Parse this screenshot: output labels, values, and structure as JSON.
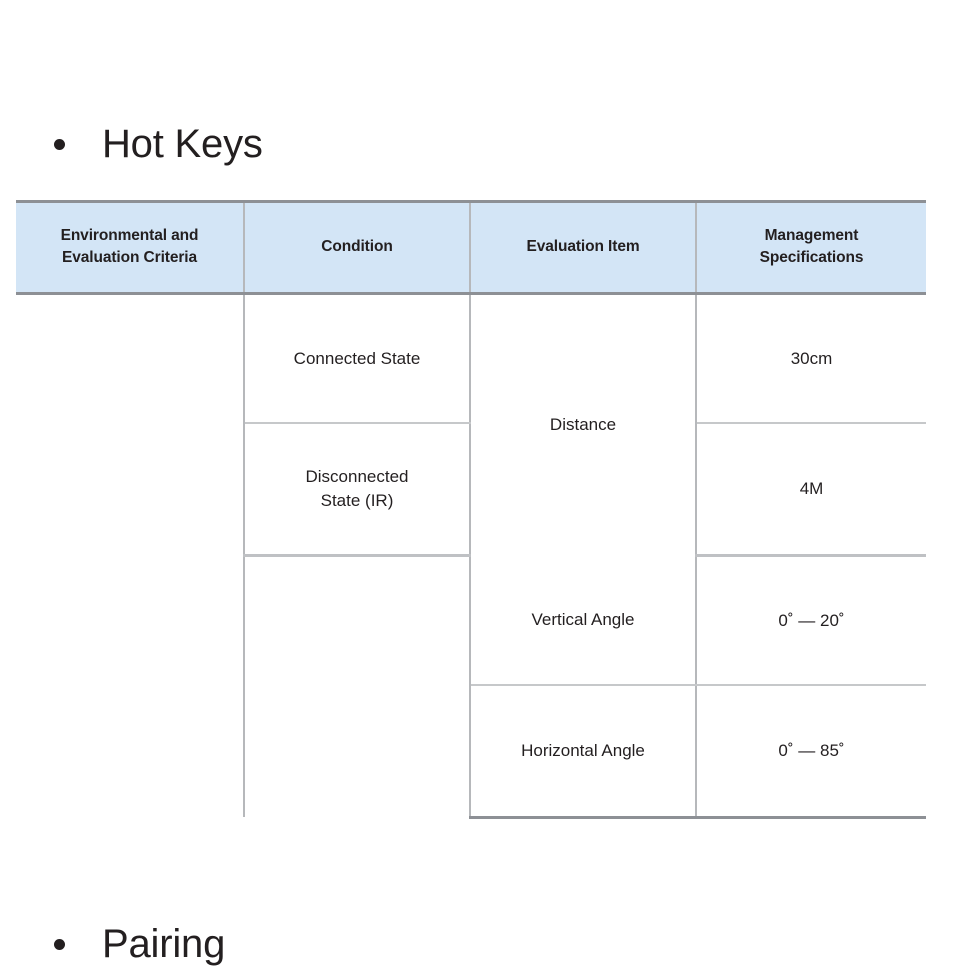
{
  "sections": [
    {
      "id": "hotkeys",
      "label": "Hot Keys",
      "bullet": "bullet-dot"
    },
    {
      "id": "pairing",
      "label": "Pairing",
      "bullet": "bullet-dot"
    }
  ],
  "table": {
    "headers": [
      "Environmental and Evaluation Criteria",
      "Condition",
      "Evaluation Item",
      "Management Specifications"
    ],
    "header_lines": {
      "col1_line1": "Environmental and",
      "col1_line2": "Evaluation Criteria",
      "col2": "Condition",
      "col3": "Evaluation Item",
      "col4_line1": "Management",
      "col4_line2": "Specifications"
    },
    "rows": [
      {
        "criteria": "",
        "condition": "Connected State",
        "evaluation_item": "Distance",
        "management_spec": "30cm"
      },
      {
        "criteria": "",
        "condition_line1": "Disconnected",
        "condition_line2": "State (IR)",
        "condition": "Disconnected State (IR)",
        "evaluation_item": "",
        "management_spec": "4M"
      },
      {
        "criteria": "",
        "condition": "",
        "evaluation_item": "Vertical Angle",
        "management_spec": "0˚ — 20˚"
      },
      {
        "criteria": "",
        "condition": "",
        "evaluation_item": "Horizontal Angle",
        "management_spec": "0˚ — 85˚"
      }
    ]
  },
  "colors": {
    "header_background": "#d3e5f6",
    "heavy_rule": "#8d9095",
    "light_rule": "#c6c8ca",
    "text": "#231f20",
    "page_background": "#ffffff"
  }
}
